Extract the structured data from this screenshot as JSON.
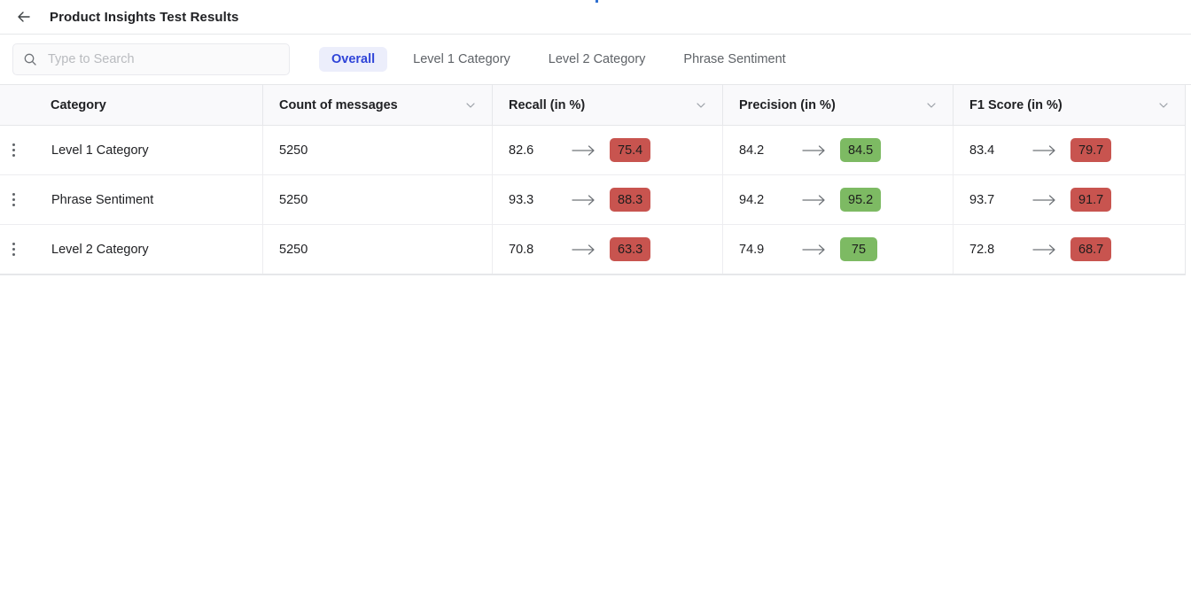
{
  "header": {
    "back_icon": "arrow-left-icon",
    "title": "Product Insights Test Results"
  },
  "toolbar": {
    "search": {
      "icon": "search-icon",
      "value": "",
      "placeholder": "Type to Search"
    },
    "tabs": [
      {
        "label": "Overall",
        "active": true
      },
      {
        "label": "Level 1 Category",
        "active": false
      },
      {
        "label": "Level 2 Category",
        "active": false
      },
      {
        "label": "Phrase Sentiment",
        "active": false
      }
    ]
  },
  "table": {
    "columns": [
      {
        "label": "Category",
        "sortable": false
      },
      {
        "label": "Count of messages",
        "sortable": true
      },
      {
        "label": "Recall (in %)",
        "sortable": true
      },
      {
        "label": "Precision (in %)",
        "sortable": true
      },
      {
        "label": "F1 Score (in %)",
        "sortable": true
      }
    ],
    "row_menu_icon": "kebab-menu-icon",
    "trend_icon": "arrow-right-icon",
    "colors": {
      "badge_red": "#c8544f",
      "badge_green": "#7dba63",
      "tab_active_text": "#2f44d8",
      "tab_active_bg": "#eceefb"
    },
    "rows": [
      {
        "category": "Level 1 Category",
        "count": "5250",
        "recall": {
          "previous": "82.6",
          "current": "75.4",
          "status": "red"
        },
        "precision": {
          "previous": "84.2",
          "current": "84.5",
          "status": "green"
        },
        "f1": {
          "previous": "83.4",
          "current": "79.7",
          "status": "red"
        }
      },
      {
        "category": "Phrase Sentiment",
        "count": "5250",
        "recall": {
          "previous": "93.3",
          "current": "88.3",
          "status": "red"
        },
        "precision": {
          "previous": "94.2",
          "current": "95.2",
          "status": "green"
        },
        "f1": {
          "previous": "93.7",
          "current": "91.7",
          "status": "red"
        }
      },
      {
        "category": "Level 2 Category",
        "count": "5250",
        "recall": {
          "previous": "70.8",
          "current": "63.3",
          "status": "red"
        },
        "precision": {
          "previous": "74.9",
          "current": "75",
          "status": "green"
        },
        "f1": {
          "previous": "72.8",
          "current": "68.7",
          "status": "red"
        }
      }
    ]
  }
}
